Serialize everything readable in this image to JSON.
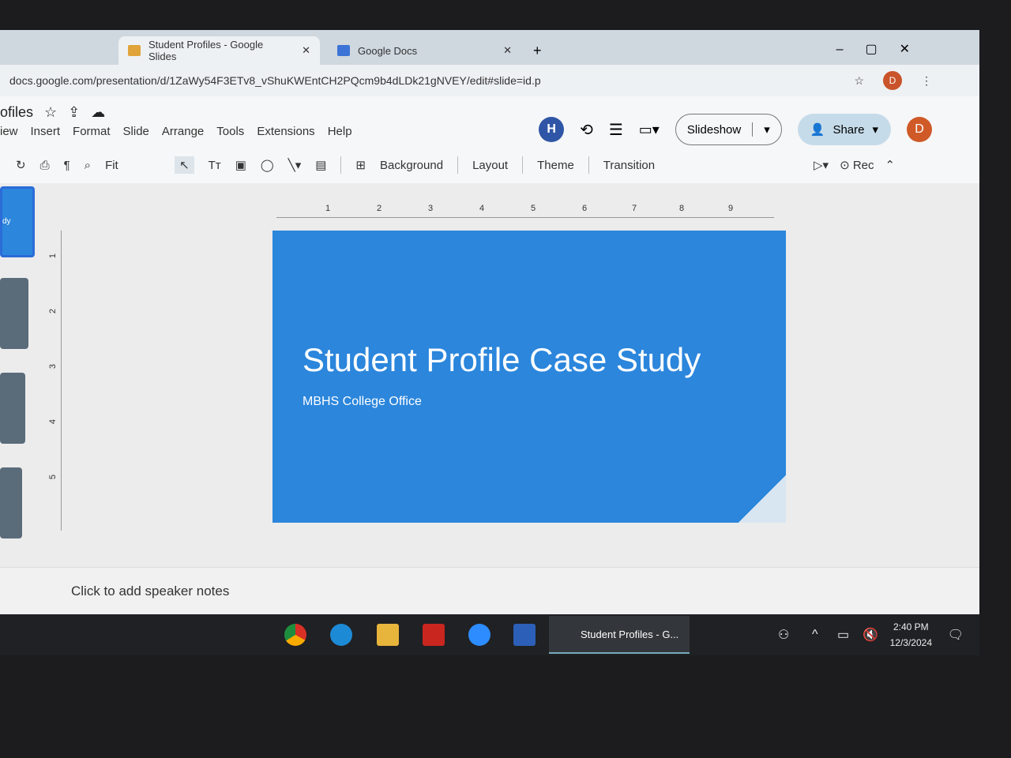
{
  "browser": {
    "tabs": [
      {
        "label": "Student Profiles - Google Slides",
        "active": true
      },
      {
        "label": "Google Docs",
        "active": false
      }
    ],
    "url": "docs.google.com/presentation/d/1ZaWy54F3ETv8_vShuKWEntCH2PQcm9b4dLDk21gNVEY/edit#slide=id.p",
    "profile_initial": "D"
  },
  "app": {
    "title": "ofiles",
    "menu": [
      "iew",
      "Insert",
      "Format",
      "Slide",
      "Arrange",
      "Tools",
      "Extensions",
      "Help"
    ],
    "collaborator_initial": "H",
    "slideshow_label": "Slideshow",
    "share_label": "Share",
    "user_initial": "D"
  },
  "toolbar": {
    "zoom": "Fit",
    "background": "Background",
    "layout": "Layout",
    "theme": "Theme",
    "transition": "Transition",
    "rec": "Rec"
  },
  "rulers": {
    "horizontal": [
      "1",
      "2",
      "3",
      "4",
      "5",
      "6",
      "7",
      "8",
      "9"
    ],
    "vertical": [
      "1",
      "2",
      "3",
      "4",
      "5"
    ]
  },
  "thumbnail_text": "dy",
  "slide": {
    "title": "Student Profile Case Study",
    "subtitle": "MBHS College Office",
    "color": "#2b86dc"
  },
  "notes_placeholder": "Click to add speaker notes",
  "taskbar": {
    "active_app": "Student Profiles - G...",
    "apps": [
      "chrome",
      "edge",
      "file-explorer",
      "acrobat",
      "zoom",
      "app"
    ],
    "time": "2:40 PM",
    "date": "12/3/2024"
  }
}
